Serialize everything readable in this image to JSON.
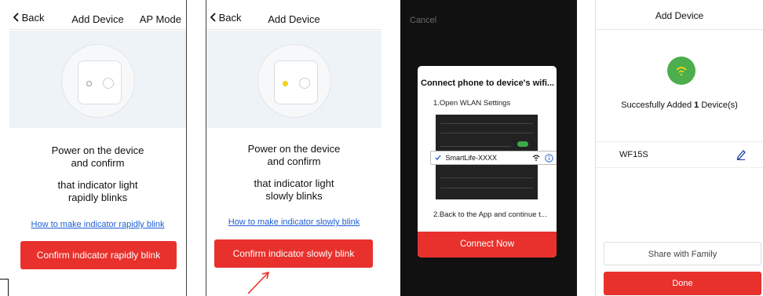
{
  "panel1": {
    "back_label": "Back",
    "title": "Add Device",
    "mode_label": "AP Mode",
    "instruction_line1": "Power on the device",
    "instruction_line2": "and confirm",
    "instruction_line3": "that indicator light",
    "instruction_line4": "rapidly blinks",
    "help_link": "How to make indicator rapidly blink",
    "confirm_button": "Confirm indicator rapidly blink",
    "indicator_color": "#ffffff"
  },
  "panel2": {
    "back_label": "Back",
    "title": "Add Device",
    "instruction_line1": "Power on the device",
    "instruction_line2": "and confirm",
    "instruction_line3": "that indicator light",
    "instruction_line4": "slowly blinks",
    "help_link": "How to make indicator slowly blink",
    "confirm_button": "Confirm indicator slowly blink",
    "indicator_color": "#f2d21b"
  },
  "panel3": {
    "cancel_label": "Cancel",
    "dialog_title": "Connect phone to device's wifi...",
    "step1": "1.Open WLAN Settings",
    "network_name": "SmartLife-XXXX",
    "step2": "2.Back to the App and continue t...",
    "connect_button": "Connect Now"
  },
  "panel4": {
    "title": "Add Device",
    "success_prefix": "Succesfully Added ",
    "success_count": "1",
    "success_suffix": " Device(s)",
    "device_name": "WF15S",
    "share_button": "Share with Family",
    "done_button": "Done"
  },
  "colors": {
    "accent_red": "#e8312c",
    "link_blue": "#1f5fd6",
    "success_green": "#4cae4c"
  },
  "icons": [
    "chevron-left-icon",
    "arrow-annotation-icon",
    "checkmark-icon",
    "wifi-icon",
    "info-icon",
    "pencil-icon"
  ]
}
